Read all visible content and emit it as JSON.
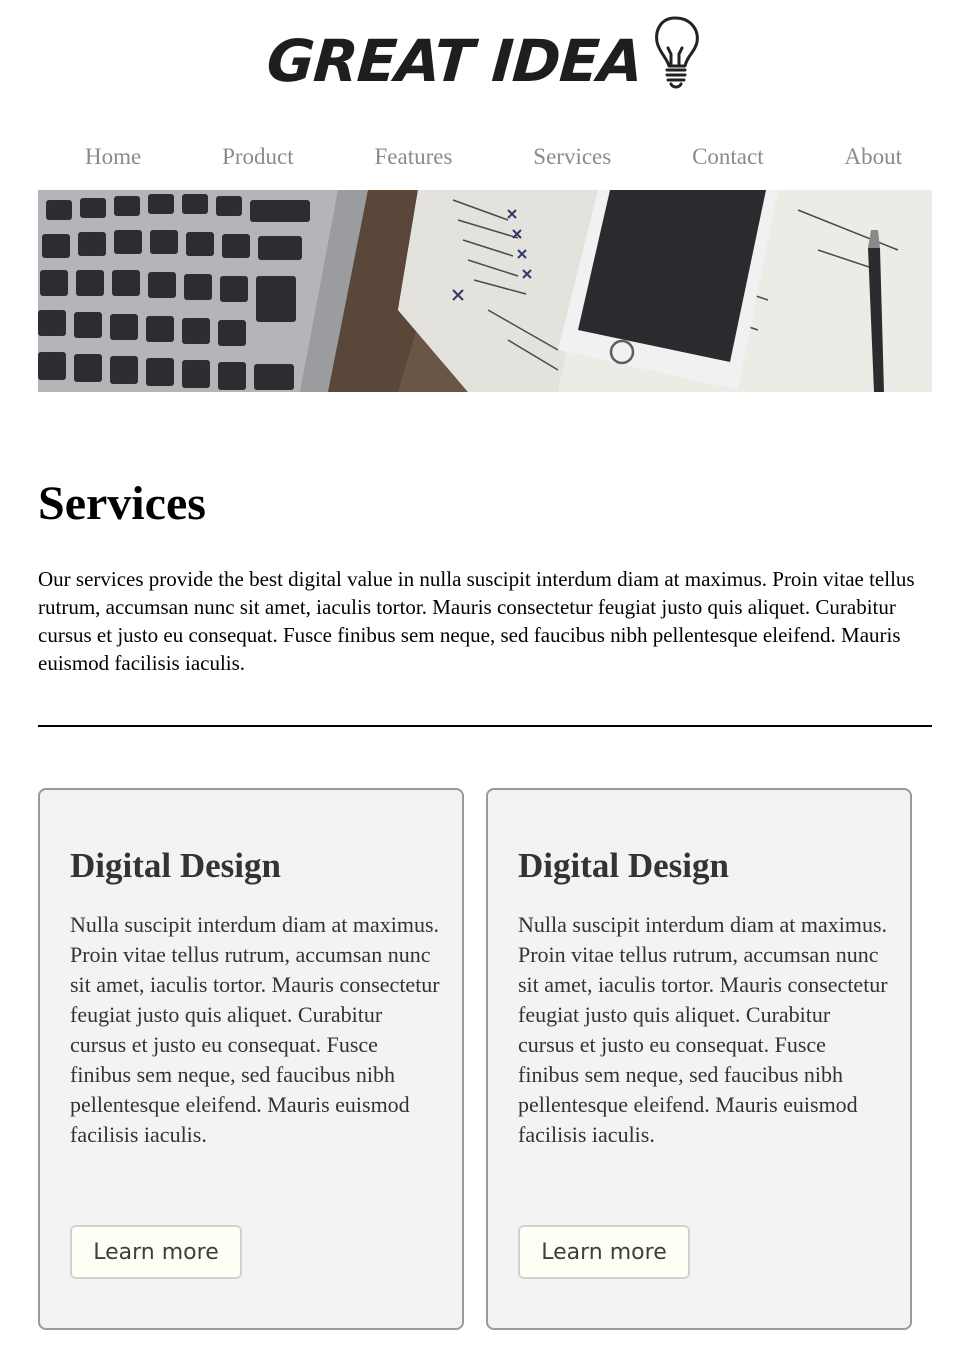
{
  "logo": {
    "text": "GREAT IDEA"
  },
  "nav": {
    "items": [
      {
        "label": "Home"
      },
      {
        "label": "Product"
      },
      {
        "label": "Features"
      },
      {
        "label": "Services"
      },
      {
        "label": "Contact"
      },
      {
        "label": "About"
      }
    ]
  },
  "hero": {
    "image": "desk-laptop-phone-notebook"
  },
  "page": {
    "title": "Services",
    "intro": "Our services provide the best digital value in nulla suscipit interdum diam at maximus. Proin vitae tellus rutrum, accumsan nunc sit amet, iaculis tortor. Mauris consectetur feugiat justo quis aliquet. Curabitur cursus et justo eu consequat. Fusce finibus sem neque, sed faucibus nibh pellentesque eleifend. Mauris euismod facilisis iaculis."
  },
  "cards": [
    {
      "title": "Digital Design",
      "body": "Nulla suscipit interdum diam at maximus. Proin vitae tellus rutrum, accumsan nunc sit amet, iaculis tortor. Mauris consectetur feugiat justo quis aliquet. Curabitur cursus et justo eu consequat. Fusce finibus sem neque, sed faucibus nibh pellentesque eleifend. Mauris euismod facilisis iaculis.",
      "button": "Learn more"
    },
    {
      "title": "Digital Design",
      "body": "Nulla suscipit interdum diam at maximus. Proin vitae tellus rutrum, accumsan nunc sit amet, iaculis tortor. Mauris consectetur feugiat justo quis aliquet. Curabitur cursus et justo eu consequat. Fusce finibus sem neque, sed faucibus nibh pellentesque eleifend. Mauris euismod facilisis iaculis.",
      "button": "Learn more"
    }
  ],
  "colors": {
    "nav_text": "#8b8b8b",
    "card_bg": "#f3f3f3",
    "card_border": "#9a9a9a",
    "button_bg": "#fffef5",
    "heading_text": "#333333"
  }
}
